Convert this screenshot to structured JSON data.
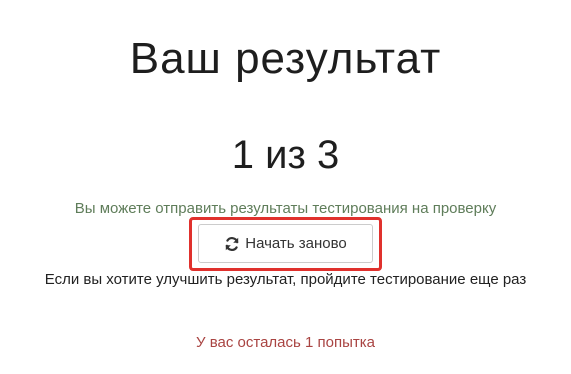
{
  "result": {
    "title": "Ваш результат",
    "score": "1 из 3",
    "submit_hint": "Вы можете отправить результаты тестирования на проверку",
    "restart_button": {
      "icon": "refresh-icon",
      "label": "Начать заново"
    },
    "improve_hint": "Если вы хотите улучшить результат, пройдите тестирование еще раз",
    "attempts_left": "У вас осталась 1 попытка"
  },
  "colors": {
    "hint_green": "#5f7d5a",
    "attempts_red": "#a94442",
    "highlight_red": "#e0312d"
  }
}
